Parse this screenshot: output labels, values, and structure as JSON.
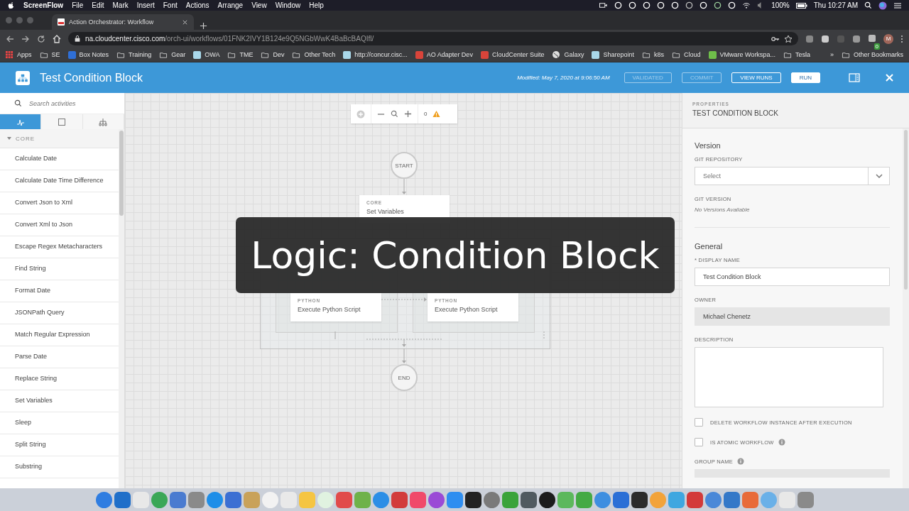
{
  "menu_bar": {
    "app": "ScreenFlow",
    "menus": [
      "File",
      "Edit",
      "Mark",
      "Insert",
      "Font",
      "Actions",
      "Arrange",
      "View",
      "Window",
      "Help"
    ],
    "battery": "100%",
    "clock": "Thu 10:27 AM"
  },
  "browser": {
    "tab_title": "Action Orchestrator: Workflow",
    "url_host": "na.cloudcenter.cisco.com",
    "url_path": "/orch-ui/workflows/01FNK2IVY1B124e9Q5NGbWwK4BaBcBAQIfl/",
    "profile": "M",
    "extension_badge": "0",
    "bookmarks": [
      {
        "label": "Apps",
        "kind": "apps"
      },
      {
        "label": "SE",
        "kind": "folder"
      },
      {
        "label": "Box Notes",
        "kind": "site",
        "color": "#2f6fd6"
      },
      {
        "label": "Training",
        "kind": "folder"
      },
      {
        "label": "Gear",
        "kind": "folder"
      },
      {
        "label": "OWA",
        "kind": "site",
        "color": "#a9d8ea"
      },
      {
        "label": "TME",
        "kind": "folder"
      },
      {
        "label": "Dev",
        "kind": "folder"
      },
      {
        "label": "Other Tech",
        "kind": "folder"
      },
      {
        "label": "http://concur.cisc...",
        "kind": "site",
        "color": "#a9d8ea"
      },
      {
        "label": "AO Adapter Dev",
        "kind": "site",
        "color": "#d9443a"
      },
      {
        "label": "CloudCenter Suite",
        "kind": "site",
        "color": "#d9443a"
      },
      {
        "label": "Galaxy",
        "kind": "globe"
      },
      {
        "label": "Sharepoint",
        "kind": "site",
        "color": "#a9d8ea"
      },
      {
        "label": "k8s",
        "kind": "folder"
      },
      {
        "label": "Cloud",
        "kind": "folder"
      },
      {
        "label": "VMware Workspa...",
        "kind": "site",
        "color": "#6fbf4a"
      },
      {
        "label": "Tesla",
        "kind": "folder"
      }
    ],
    "overflow": "»",
    "other_bookmarks": "Other Bookmarks"
  },
  "header": {
    "title": "Test Condition Block",
    "modified": "Modified: May 7, 2020 at 9:06:50 AM",
    "buttons": [
      {
        "label": "VALIDATED",
        "kind": "outline",
        "disabled": true
      },
      {
        "label": "COMMIT",
        "kind": "outline",
        "disabled": true
      },
      {
        "label": "VIEW RUNS",
        "kind": "outline",
        "disabled": false
      },
      {
        "label": "RUN",
        "kind": "primary",
        "disabled": false
      }
    ]
  },
  "sidebar": {
    "search_placeholder": "Search activities",
    "tabs": [
      {
        "kind": "activity",
        "selected": true
      },
      {
        "kind": "square",
        "selected": false
      },
      {
        "kind": "tree",
        "selected": false
      }
    ],
    "category": {
      "label": "CORE",
      "expanded": true
    },
    "items": [
      "Calculate Date",
      "Calculate Date Time Difference",
      "Convert Json to Xml",
      "Convert Xml to Json",
      "Escape Regex Metacharacters",
      "Find String",
      "Format Date",
      "JSONPath Query",
      "Match Regular Expression",
      "Parse Date",
      "Replace String",
      "Set Variables",
      "Sleep",
      "Split String",
      "Substring"
    ]
  },
  "canvas": {
    "warning_count": "0",
    "start": "START",
    "end": "END",
    "first_task": {
      "category": "CORE",
      "title": "Set Variables"
    },
    "branch_tasks": [
      {
        "category": "PYTHON",
        "title": "Execute Python Script"
      },
      {
        "category": "PYTHON",
        "title": "Execute Python Script"
      }
    ]
  },
  "caption": "Logic: Condition Block",
  "properties": {
    "eyebrow": "PROPERTIES",
    "title": "TEST CONDITION BLOCK",
    "version_heading": "Version",
    "git_repository_label": "GIT REPOSITORY",
    "git_repository_placeholder": "Select",
    "git_version_label": "GIT VERSION",
    "git_version_value": "No Versions Available",
    "general_heading": "General",
    "display_name_label": "* DISPLAY NAME",
    "display_name_value": "Test Condition Block",
    "owner_label": "OWNER",
    "owner_value": "Michael Chenetz",
    "description_label": "DESCRIPTION",
    "checkboxes": [
      {
        "label": "DELETE WORKFLOW INSTANCE AFTER EXECUTION",
        "checked": false,
        "info": false
      },
      {
        "label": "IS ATOMIC WORKFLOW",
        "checked": false,
        "info": true
      }
    ],
    "group_name_label": "GROUP NAME",
    "group_name_info": true
  }
}
